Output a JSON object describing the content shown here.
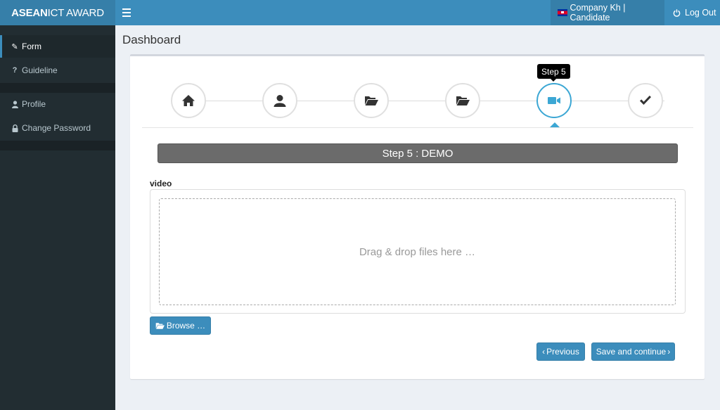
{
  "header": {
    "brand_bold": "ASEAN",
    "brand_light": "ICT AWARD",
    "user_label": "Company Kh | Candidate",
    "logout_label": "Log Out",
    "accent_color": "#3c8dbc"
  },
  "sidebar": {
    "items": [
      {
        "label": "Form",
        "icon": "pencil-icon",
        "active": true
      },
      {
        "label": "Guideline",
        "icon": "question-icon",
        "active": false
      },
      {
        "label": "Profile",
        "icon": "user-icon",
        "active": false
      },
      {
        "label": "Change Password",
        "icon": "lock-icon",
        "active": false
      }
    ]
  },
  "page": {
    "title": "Dashboard"
  },
  "wizard": {
    "tooltip": "Step 5",
    "steps": [
      {
        "icon": "home-icon"
      },
      {
        "icon": "user-icon"
      },
      {
        "icon": "folder-open-icon"
      },
      {
        "icon": "folder-open-icon"
      },
      {
        "icon": "video-camera-icon",
        "active": true
      },
      {
        "icon": "checkmark-icon"
      }
    ],
    "current_step_title": "Step 5 : DEMO"
  },
  "upload": {
    "label": "video",
    "dropzone_text": "Drag & drop files here …",
    "browse_label": "Browse …"
  },
  "actions": {
    "previous_label": "Previous",
    "save_label": "Save and continue"
  }
}
